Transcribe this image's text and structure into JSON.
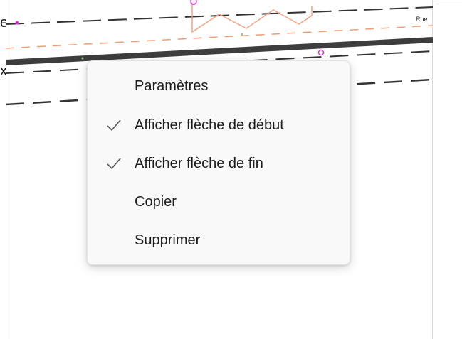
{
  "edge_text": {
    "line1": "e,",
    "line2": "x"
  },
  "map": {
    "street_label": "Rue"
  },
  "context_menu": {
    "items": [
      {
        "label": "Paramètres",
        "checked": false
      },
      {
        "label": "Afficher flèche de début",
        "checked": true
      },
      {
        "label": "Afficher flèche de fin",
        "checked": true
      },
      {
        "label": "Copier",
        "checked": false
      },
      {
        "label": "Supprimer",
        "checked": false
      }
    ]
  },
  "colors": {
    "road_edge": "#3d3d3d",
    "lane_dash": "#333333",
    "orange_dash": "#f29b73",
    "zigzag": "#f1a283",
    "marker_magenta": "#d53ad5",
    "checkmark": "#555555"
  }
}
